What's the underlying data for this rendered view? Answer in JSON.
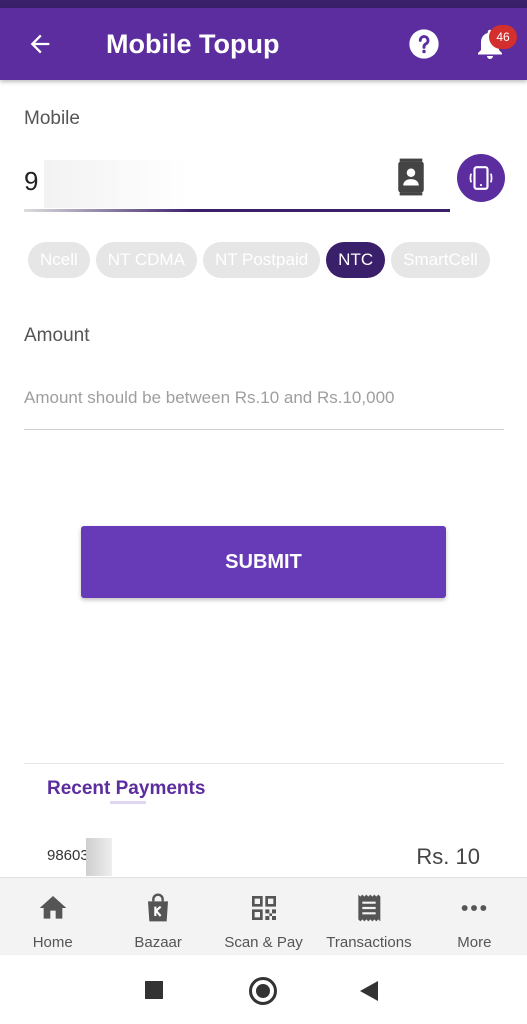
{
  "header": {
    "title": "Mobile Topup",
    "notification_count": "46",
    "color": "#5b2d9e"
  },
  "mobile": {
    "label": "Mobile",
    "value": "9"
  },
  "operators": [
    {
      "label": "Ncell",
      "selected": false
    },
    {
      "label": "NT CDMA",
      "selected": false
    },
    {
      "label": "NT Postpaid",
      "selected": false
    },
    {
      "label": "NTC",
      "selected": true
    },
    {
      "label": "SmartCell",
      "selected": false
    }
  ],
  "amount": {
    "label": "Amount",
    "placeholder": "Amount should be between Rs.10 and Rs.10,000",
    "value": ""
  },
  "submit": {
    "label": "SUBMIT",
    "color": "#673ab7"
  },
  "recent": {
    "title": "Recent Payments",
    "items": [
      {
        "number": "98603",
        "amount": "Rs. 10"
      }
    ]
  },
  "bottom_nav": [
    {
      "label": "Home",
      "icon": "home-icon"
    },
    {
      "label": "Bazaar",
      "icon": "shopping-bag-icon"
    },
    {
      "label": "Scan & Pay",
      "icon": "qr-code-icon"
    },
    {
      "label": "Transactions",
      "icon": "receipt-icon"
    },
    {
      "label": "More",
      "icon": "more-dots-icon"
    }
  ]
}
